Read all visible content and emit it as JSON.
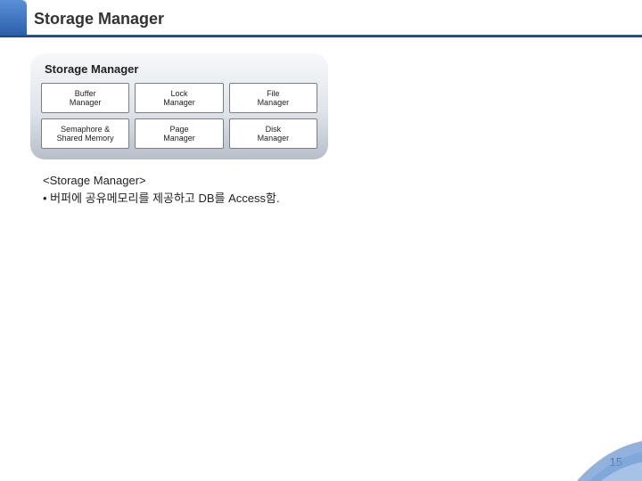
{
  "header": {
    "title": "Storage Manager"
  },
  "panel": {
    "title": "Storage Manager",
    "cells": [
      "Buffer\nManager",
      "Lock\nManager",
      "File\nManager",
      "Semaphore &\nShared Memory",
      "Page\nManager",
      "Disk\nManager"
    ]
  },
  "description": {
    "line1": "<Storage Manager>",
    "line2": "• 버퍼에 공유메모리를 제공하고 DB를 Access함."
  },
  "page_number": "15"
}
